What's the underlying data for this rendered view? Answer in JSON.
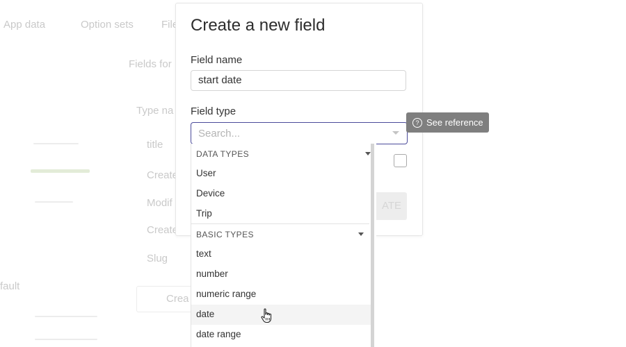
{
  "background": {
    "nav_tabs": [
      "App data",
      "Option sets",
      "File"
    ],
    "fields_for": "Fields for",
    "type_name": "Type na",
    "rows": [
      "title",
      "Create",
      "Modif",
      "Create",
      "Slug"
    ],
    "default_label": "fault",
    "create_button": "Crea"
  },
  "dialog": {
    "title": "Create a new field",
    "field_name_label": "Field name",
    "field_name_value": "start date",
    "field_type_label": "Field type",
    "search_placeholder": "Search...",
    "create_label": "ATE"
  },
  "tooltip": {
    "label": "See reference"
  },
  "dropdown": {
    "sections": [
      {
        "header": "DATA TYPES",
        "items": [
          "User",
          "Device",
          "Trip"
        ]
      },
      {
        "header": "BASIC TYPES",
        "items": [
          "text",
          "number",
          "numeric range",
          "date",
          "date range"
        ]
      }
    ],
    "hovered_item": "date"
  }
}
